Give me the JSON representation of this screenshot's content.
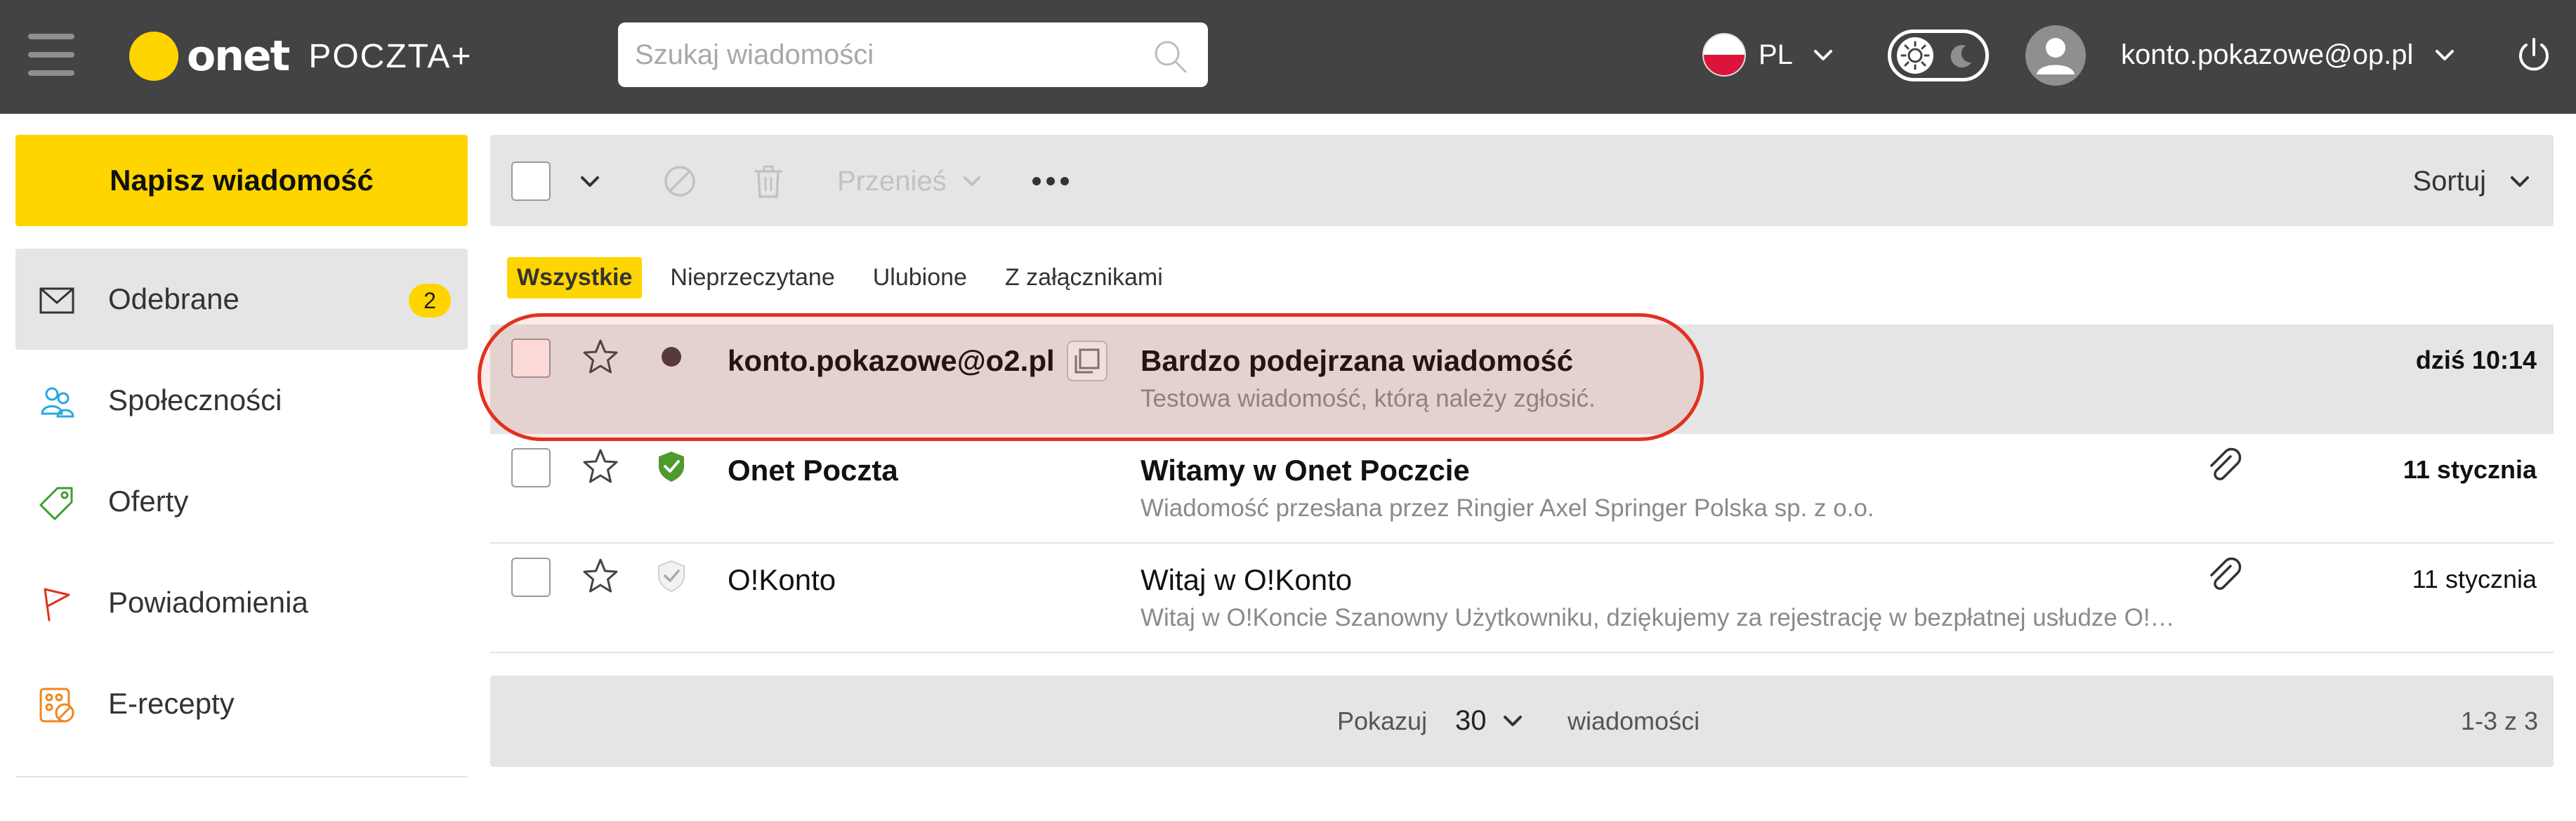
{
  "header": {
    "logo_text": "onet",
    "logo_sub": "POCZTA+",
    "search_placeholder": "Szukaj wiadomości",
    "language": "PL",
    "account_email": "konto.pokazowe@op.pl"
  },
  "sidebar": {
    "compose_label": "Napisz wiadomość",
    "folders": [
      {
        "label": "Odebrane",
        "badge": "2",
        "icon": "envelope-icon",
        "active": true
      },
      {
        "label": "Społeczności",
        "icon": "people-icon"
      },
      {
        "label": "Oferty",
        "icon": "tag-icon"
      },
      {
        "label": "Powiadomienia",
        "icon": "flag-icon"
      },
      {
        "label": "E-recepty",
        "icon": "pills-icon"
      }
    ]
  },
  "toolbar": {
    "move_label": "Przenieś",
    "sort_label": "Sortuj"
  },
  "filters": [
    "Wszystkie",
    "Nieprzeczytane",
    "Ulubione",
    "Z załącznikami"
  ],
  "messages": [
    {
      "sender": "konto.pokazowe@o2.pl",
      "subject": "Bardzo podejrzana wiadomość",
      "preview": "Testowa wiadomość, którą należy zgłosić.",
      "date": "dziś 10:14",
      "unread": true,
      "status": "unread-dot-icon"
    },
    {
      "sender": "Onet Poczta",
      "subject": "Witamy w Onet Poczcie",
      "preview": "Wiadomość przesłana przez Ringier Axel Springer Polska sp. z o.o.",
      "date": "11 stycznia",
      "unread": true,
      "status": "verified-shield-icon",
      "attachment": true
    },
    {
      "sender": "O!Konto",
      "subject": "Witaj w O!Konto",
      "preview": "Witaj w O!Koncie Szanowny Użytkowniku, dziękujemy za rejestrację w bezpłatnej usłudze O!Konto.",
      "date": "11 stycznia",
      "unread": false,
      "status": "shield-outline-icon",
      "attachment": true
    }
  ],
  "pager": {
    "show_label": "Pokazuj",
    "per_page": "30",
    "suffix": "wiadomości",
    "range": "1-3 z 3"
  },
  "colors": {
    "header_bg": "#434343",
    "accent": "#ffd500",
    "highlight": "#e0321e",
    "verified": "#4e9a2e"
  }
}
